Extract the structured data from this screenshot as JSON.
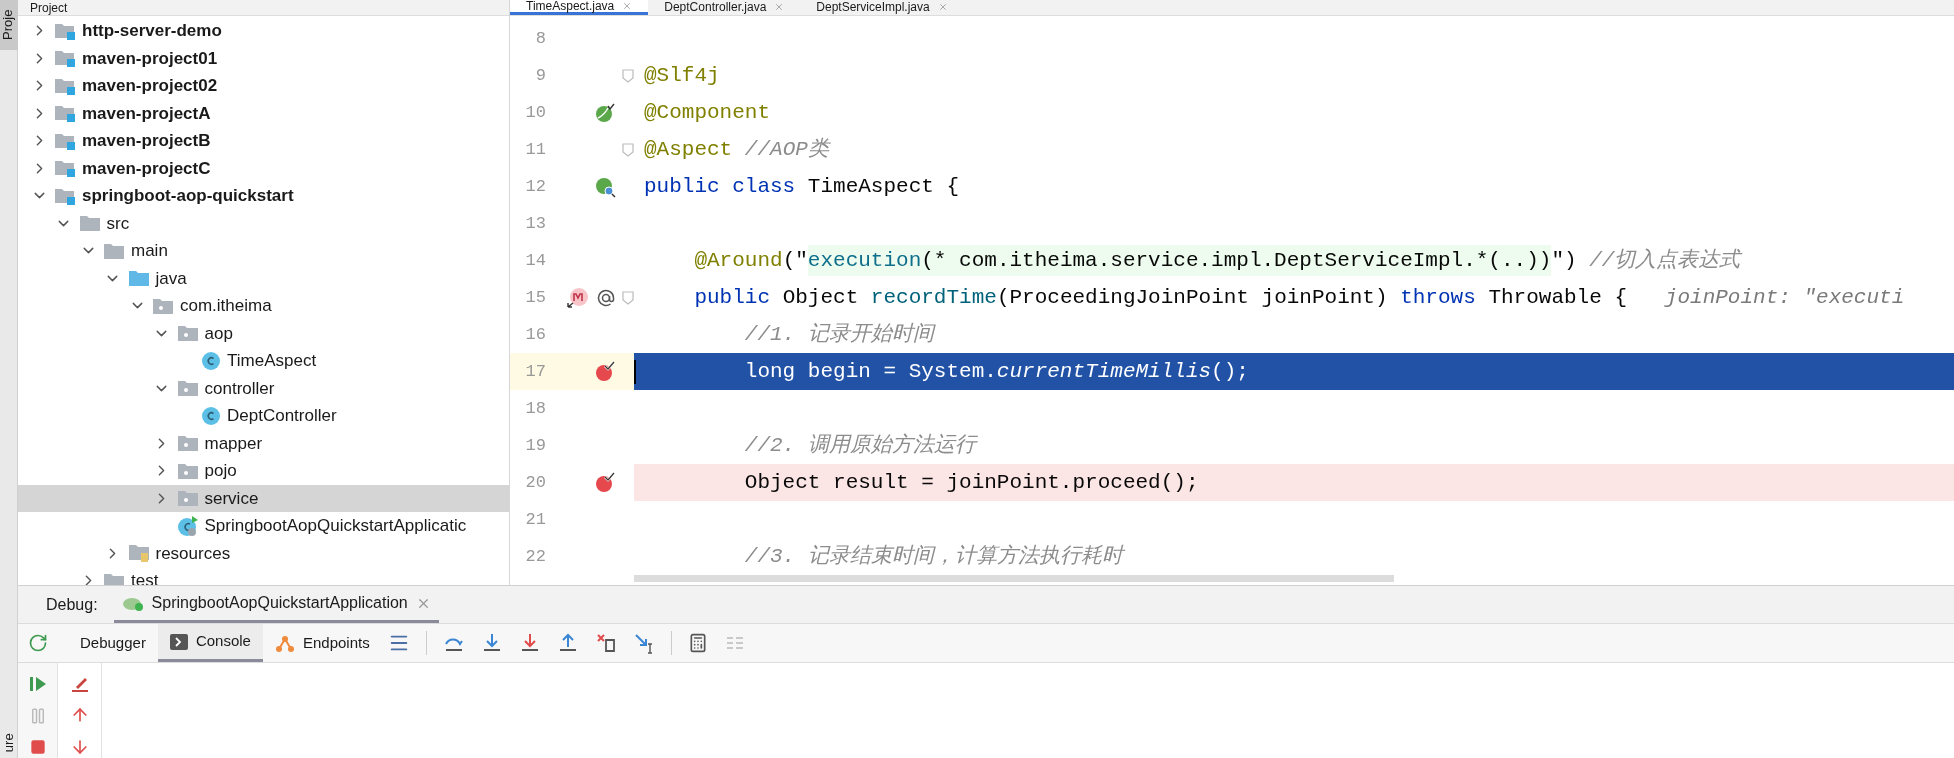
{
  "left_stripe": {
    "top_label": "Proje",
    "bottom_label": "ure"
  },
  "project_panel": {
    "title": "Project",
    "tree": [
      {
        "label": "http-server-demo",
        "kind": "module",
        "expanded": false,
        "selected": false
      },
      {
        "label": "maven-project01",
        "kind": "module",
        "expanded": false,
        "selected": false
      },
      {
        "label": "maven-project02",
        "kind": "module",
        "expanded": false,
        "selected": false
      },
      {
        "label": "maven-projectA",
        "kind": "module",
        "expanded": false,
        "selected": false
      },
      {
        "label": "maven-projectB",
        "kind": "module",
        "expanded": false,
        "selected": false
      },
      {
        "label": "maven-projectC",
        "kind": "module",
        "expanded": false,
        "selected": false
      },
      {
        "label": "springboot-aop-quickstart",
        "kind": "module",
        "expanded": true,
        "selected": false,
        "children": [
          {
            "label": "src",
            "kind": "folder",
            "expanded": true,
            "selected": false,
            "children": [
              {
                "label": "main",
                "kind": "folder",
                "expanded": true,
                "selected": false,
                "children": [
                  {
                    "label": "java",
                    "kind": "source",
                    "expanded": true,
                    "selected": false,
                    "children": [
                      {
                        "label": "com.itheima",
                        "kind": "package",
                        "expanded": true,
                        "selected": false,
                        "children": [
                          {
                            "label": "aop",
                            "kind": "package",
                            "expanded": true,
                            "selected": false,
                            "children": [
                              {
                                "label": "TimeAspect",
                                "kind": "class",
                                "selected": false
                              }
                            ]
                          },
                          {
                            "label": "controller",
                            "kind": "package",
                            "expanded": true,
                            "selected": false,
                            "children": [
                              {
                                "label": "DeptController",
                                "kind": "class",
                                "selected": false
                              }
                            ]
                          },
                          {
                            "label": "mapper",
                            "kind": "package",
                            "expanded": false,
                            "selected": false
                          },
                          {
                            "label": "pojo",
                            "kind": "package",
                            "expanded": false,
                            "selected": false
                          },
                          {
                            "label": "service",
                            "kind": "package",
                            "expanded": false,
                            "selected": true
                          },
                          {
                            "label": "SpringbootAopQuickstartApplicatic",
                            "kind": "app",
                            "selected": false
                          }
                        ]
                      }
                    ]
                  },
                  {
                    "label": "resources",
                    "kind": "resources",
                    "expanded": false,
                    "selected": false
                  }
                ]
              },
              {
                "label": "test",
                "kind": "folder",
                "expanded": false,
                "selected": false
              }
            ]
          }
        ]
      }
    ]
  },
  "editor": {
    "tabs": [
      {
        "label": "TimeAspect.java",
        "selected": true
      },
      {
        "label": "DeptController.java",
        "selected": false
      },
      {
        "label": "DeptServiceImpl.java",
        "selected": false
      }
    ],
    "lines": [
      {
        "number": "8",
        "kind": "plain",
        "fold": false,
        "breakpoint": false,
        "current": false
      },
      {
        "number": "9",
        "kind": "plain",
        "fold": true,
        "breakpoint": false,
        "current": false,
        "segments": [
          {
            "text": "@Slf4j",
            "kind": "annotation"
          }
        ]
      },
      {
        "number": "10",
        "kind": "bean",
        "fold": false,
        "breakpoint": false,
        "current": false,
        "segments": [
          {
            "text": "@Component",
            "kind": "annotation"
          }
        ]
      },
      {
        "number": "11",
        "kind": "plain",
        "fold": true,
        "breakpoint": false,
        "current": false,
        "segments": [
          {
            "text": "@Aspect",
            "kind": "annotation"
          },
          {
            "text": " //AOP类",
            "kind": "comment"
          }
        ]
      },
      {
        "number": "12",
        "kind": "bean-class",
        "fold": false,
        "breakpoint": false,
        "current": false,
        "segments": [
          {
            "text": "public class",
            "kind": "keyword"
          },
          {
            "text": " TimeAspect {",
            "kind": "plain"
          }
        ]
      },
      {
        "number": "13",
        "kind": "plain",
        "fold": false,
        "breakpoint": false,
        "current": false
      },
      {
        "number": "14",
        "kind": "plain",
        "fold": false,
        "breakpoint": false,
        "current": false,
        "segments": [
          {
            "text": "    @Around",
            "kind": "annotation"
          },
          {
            "text": "(\"",
            "kind": "plain"
          },
          {
            "text": "execution",
            "kind": "injected-keyword"
          },
          {
            "text": "(* com.itheima.service.impl.DeptServiceImpl.*(..))",
            "kind": "injected"
          },
          {
            "text": "\")",
            "kind": "plain"
          },
          {
            "text": " //切入点表达式",
            "kind": "comment"
          }
        ]
      },
      {
        "number": "15",
        "kind": "advice-method",
        "fold": true,
        "breakpoint": false,
        "current": false,
        "segments": [
          {
            "text": "    public",
            "kind": "keyword"
          },
          {
            "text": " Object ",
            "kind": "plain"
          },
          {
            "text": "recordTime",
            "kind": "method"
          },
          {
            "text": "(ProceedingJoinPoint joinPoint) ",
            "kind": "plain"
          },
          {
            "text": "throws",
            "kind": "keyword"
          },
          {
            "text": " Throwable {",
            "kind": "plain"
          },
          {
            "text": "   joinPoint: \"executi",
            "kind": "hint"
          }
        ]
      },
      {
        "number": "16",
        "kind": "plain",
        "fold": false,
        "breakpoint": false,
        "current": false,
        "segments": [
          {
            "text": "        //1. 记录开始时间",
            "kind": "comment"
          }
        ]
      },
      {
        "number": "17",
        "kind": "plain",
        "fold": false,
        "breakpoint": true,
        "current": true,
        "segments": [
          {
            "text": "        long begin = System.",
            "kind": "plain"
          },
          {
            "text": "currentTimeMillis",
            "kind": "static"
          },
          {
            "text": "();",
            "kind": "plain"
          }
        ]
      },
      {
        "number": "18",
        "kind": "plain",
        "fold": false,
        "breakpoint": false,
        "current": false
      },
      {
        "number": "19",
        "kind": "plain",
        "fold": false,
        "breakpoint": false,
        "current": false,
        "segments": [
          {
            "text": "        //2. 调用原始方法运行",
            "kind": "comment"
          }
        ]
      },
      {
        "number": "20",
        "kind": "plain",
        "fold": false,
        "breakpoint": true,
        "current": false,
        "segments": [
          {
            "text": "        Object result = joinPoint.proceed();",
            "kind": "plain"
          }
        ]
      },
      {
        "number": "21",
        "kind": "plain",
        "fold": false,
        "breakpoint": false,
        "current": false
      },
      {
        "number": "22",
        "kind": "plain",
        "fold": false,
        "breakpoint": false,
        "current": false,
        "segments": [
          {
            "text": "        //3. 记录结束时间，计算方法执行耗时",
            "kind": "comment"
          }
        ]
      }
    ]
  },
  "debug": {
    "label": "Debug:",
    "session": "SpringbootAopQuickstartApplication",
    "tabs": [
      {
        "label": "Debugger",
        "selected": false
      },
      {
        "label": "Console",
        "selected": true
      },
      {
        "label": "Endpoints",
        "selected": false
      }
    ]
  }
}
